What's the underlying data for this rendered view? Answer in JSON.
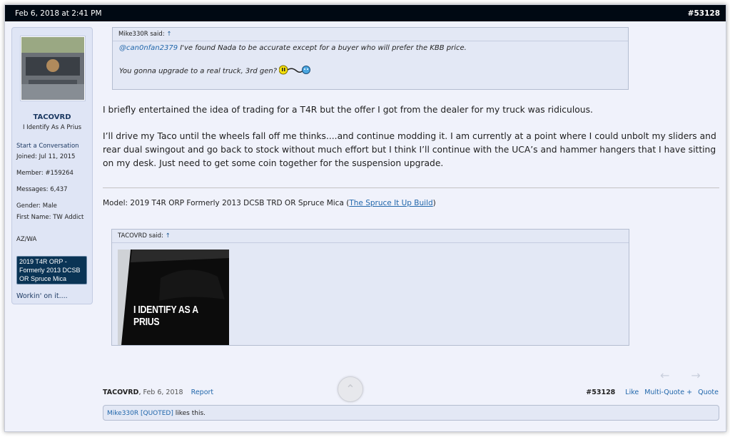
{
  "post": {
    "date": "Feb 6, 2018 at 2:41 PM",
    "number": "#53128"
  },
  "user": {
    "name": "TACOVRD",
    "title": "I Identify As A Prius",
    "start_conversation": "Start a Conversation",
    "joined": "Joined: Jul 11, 2015",
    "member": "Member: #159264",
    "messages": "Messages: 6,437",
    "gender": "Gender: Male",
    "first_name": "First Name: TW Addict",
    "location": "AZ/WA",
    "vehicle": "2019 T4R ORP - Formerly 2013 DCSB OR Spruce Mica",
    "working": "Workin' on it...."
  },
  "quote1": {
    "author": "Mike330R said:",
    "arrow": "↑",
    "mention": "@can0nfan2379",
    "line1": " I've found Nada to be accurate except for a buyer who will prefer the KBB price.",
    "line2": "You gonna upgrade to a real truck, 3rd gen?"
  },
  "message": {
    "para1": "I briefly entertained the idea of trading for a T4R but the offer I got from the dealer for my truck was ridiculous.",
    "para2": "I’ll drive my Taco until the wheels fall off me thinks....and continue modding it. I am currently at a point where I could unbolt my sliders and rear dual swingout and go back to stock without much effort but I think I’ll continue with the UCA’s and hammer hangers that I have sitting on my desk. Just need to get some coin together for the suspension upgrade."
  },
  "signature": {
    "text": "Model: 2019 T4R ORP Formerly 2013 DCSB TRD OR Spruce Mica (",
    "link": "The Spruce It Up Build",
    "close": ")"
  },
  "quote2": {
    "author": "TACOVRD said:",
    "arrow": "↑",
    "image_text": "I IDENTIFY AS A PRIUS"
  },
  "footer": {
    "author": "TACOVRD",
    "date": "Feb 6, 2018",
    "report": "Report",
    "number": "#53128",
    "like": "Like",
    "multiquote": "Multi-Quote +",
    "quote": "Quote"
  },
  "likes": {
    "user": "Mike330R [QUOTED]",
    "text": " likes this."
  },
  "icons": {
    "prev": "arrow-left-icon",
    "next": "arrow-right-icon",
    "scroll": "chevron-up-icon"
  }
}
